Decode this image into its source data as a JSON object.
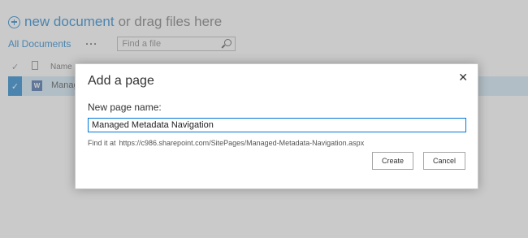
{
  "library": {
    "new_document_label": "new document",
    "drag_text": "or drag files here",
    "view_label": "All Documents",
    "more_label": "···",
    "search_placeholder": "Find a file",
    "columns": {
      "name": "Name"
    },
    "row": {
      "name": "Managed Metadata Navigation"
    }
  },
  "dialog": {
    "title": "Add a page",
    "close_symbol": "✕",
    "field_label": "New page name:",
    "field_value": "Managed Metadata Navigation",
    "find_prefix": "Find it at",
    "find_url": "https://c986.sharepoint.com/SitePages/Managed-Metadata-Navigation.aspx",
    "create_label": "Create",
    "cancel_label": "Cancel"
  },
  "colors": {
    "accent": "#0072c6",
    "selection_row": "#cde6f7",
    "word_icon": "#2b579a",
    "input_focus": "#0078d7"
  },
  "icons": {
    "new_document": "plus-circle-icon",
    "search": "search-icon",
    "row_check": "checkmark-icon",
    "file": "document-icon",
    "word": "word-document-icon",
    "close": "close-icon"
  }
}
